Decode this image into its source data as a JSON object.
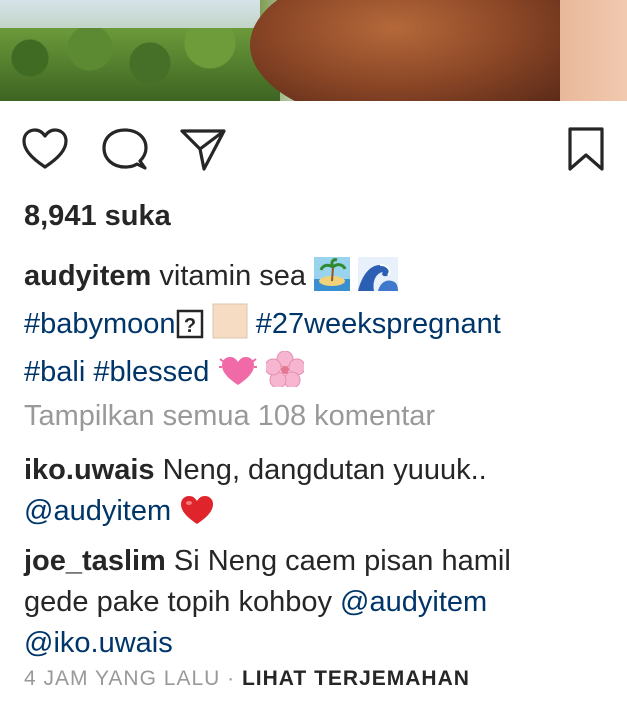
{
  "post": {
    "likes": "8,941 suka",
    "caption": {
      "username": "audyitem",
      "text": "vitamin sea",
      "hashtags_line1": [
        "#babymoon",
        "#27weekspregnant"
      ],
      "hashtags_line2": [
        "#bali",
        "#blessed"
      ]
    },
    "view_all_comments": "Tampilkan semua 108 komentar",
    "comments": [
      {
        "username": "iko.uwais",
        "text": "Neng, dangdutan yuuuk..",
        "mention": "@audyitem"
      },
      {
        "username": "joe_taslim",
        "text_line1": "Si Neng caem pisan hamil",
        "text_line2": "gede pake topih kohboy",
        "mention1": "@audyitem",
        "mention2": "@iko.uwais"
      }
    ],
    "timestamp": "4 JAM YANG LALU",
    "separator": "·",
    "translate": "LIHAT TERJEMAHAN"
  },
  "icons": [
    "heart-icon",
    "comment-icon",
    "share-icon",
    "bookmark-icon"
  ],
  "colors": {
    "text": "#262626",
    "link": "#003569",
    "muted": "#999999"
  }
}
